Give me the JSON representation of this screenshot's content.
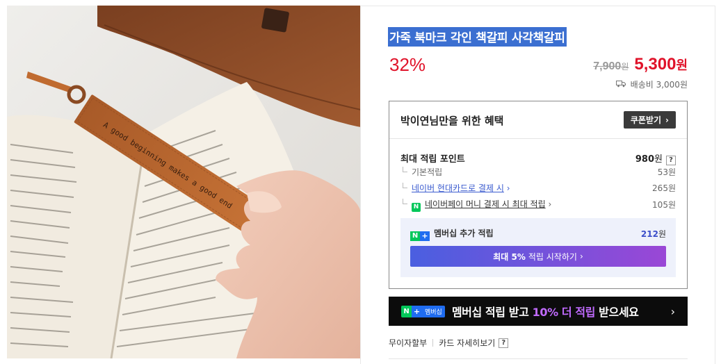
{
  "product": {
    "title": "가죽 북마크 각인 책갈피 사각책갈피",
    "discount_rate": "32%",
    "original_price": "7,900",
    "original_unit": "원",
    "sale_price": "5,300",
    "sale_unit": "원",
    "shipping": "배송비 3,000원",
    "image": {
      "engraving": "A good beginning makes a good end"
    }
  },
  "benefit": {
    "title": "박이연님만을 위한 혜택",
    "coupon_button": "쿠폰받기",
    "max_point_label": "최대 적립 포인트",
    "max_point_value": "980",
    "max_point_unit": "원",
    "help": "?",
    "rows": [
      {
        "label": "기본적립",
        "value": "53원"
      },
      {
        "label": "네이버 현대카드로 결제 시",
        "value": "265원"
      },
      {
        "label": "네이버페이 머니 결제 시 최대 적립",
        "value": "105원"
      }
    ],
    "membership": {
      "label": "멤버십 추가 적립",
      "value": "212",
      "unit": "원",
      "button_bold": "최대 5%",
      "button_rest": "적립 시작하기"
    }
  },
  "banner": {
    "badge_text": "멤버십",
    "text_before": "멤버십 적립 받고 ",
    "text_highlight": "10% 더 적립",
    "text_after": " 받으세요"
  },
  "links": {
    "installment": "무이자할부",
    "card_detail": "카드 자세히보기",
    "help": "?"
  },
  "colors": {
    "sale_red": "#e0132a",
    "naver_green": "#03c75a",
    "membership_blue": "#3b4ec9",
    "title_highlight": "#3b6fd1"
  }
}
